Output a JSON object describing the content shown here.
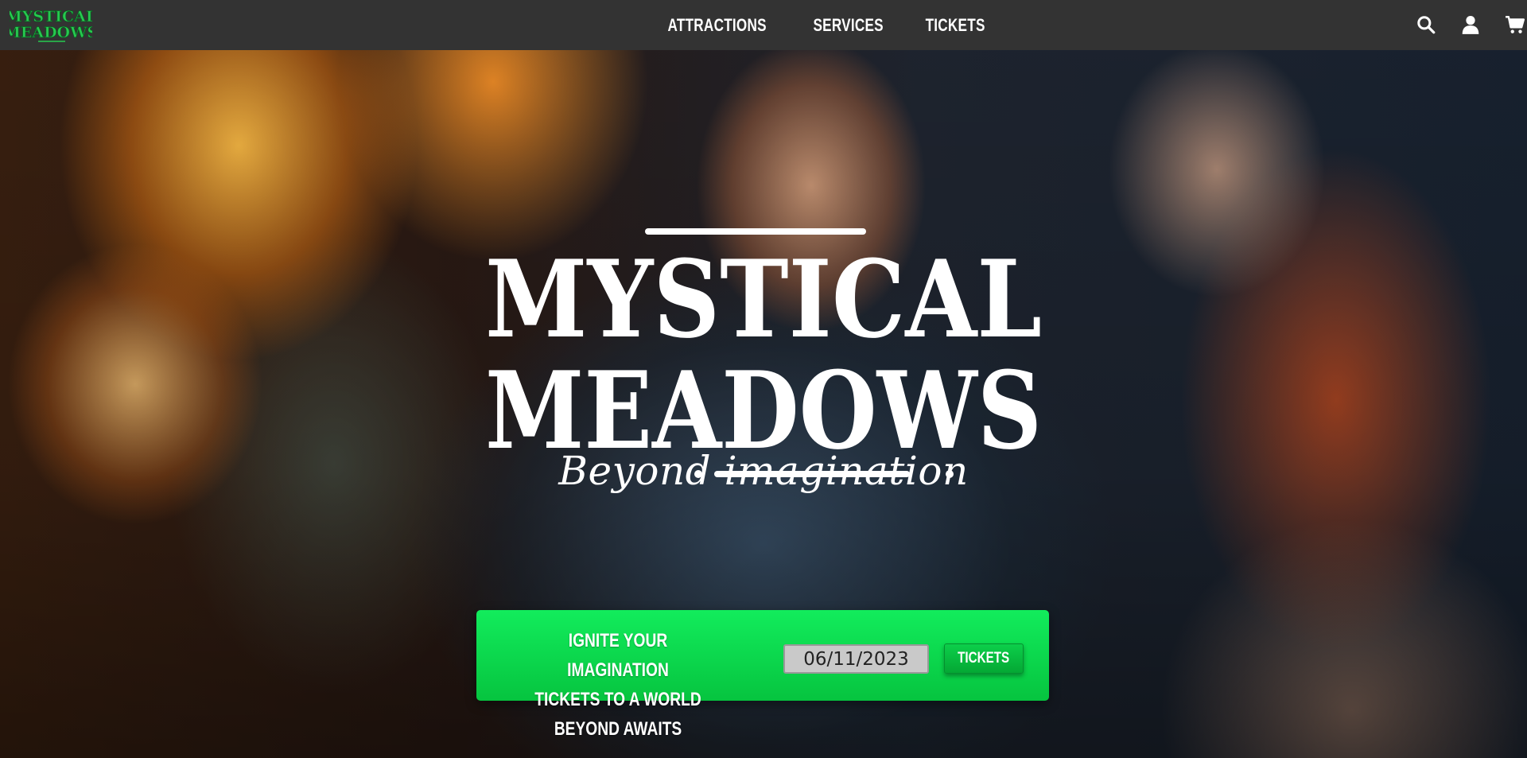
{
  "brand": {
    "logo_line1": "MYSTICAL",
    "logo_line2": "MEADOWS",
    "logo_color": "#27c94f"
  },
  "nav": {
    "links": [
      "ATTRACTIONS",
      "SERVICES",
      "TICKETS"
    ],
    "icons": [
      "search-icon",
      "user-icon",
      "cart-icon"
    ],
    "background": "#333333"
  },
  "hero": {
    "title_line1": "MYSTICAL",
    "title_line2": "MEADOWS",
    "tagline": "Beyond imagination"
  },
  "cta": {
    "line1": "IGNITE YOUR IMAGINATION",
    "line2": "TICKETS TO A WORLD BEYOND AWAITS",
    "date_value": "06/11/2023",
    "button_label": "TICKETS",
    "accent": "#0fe356"
  }
}
